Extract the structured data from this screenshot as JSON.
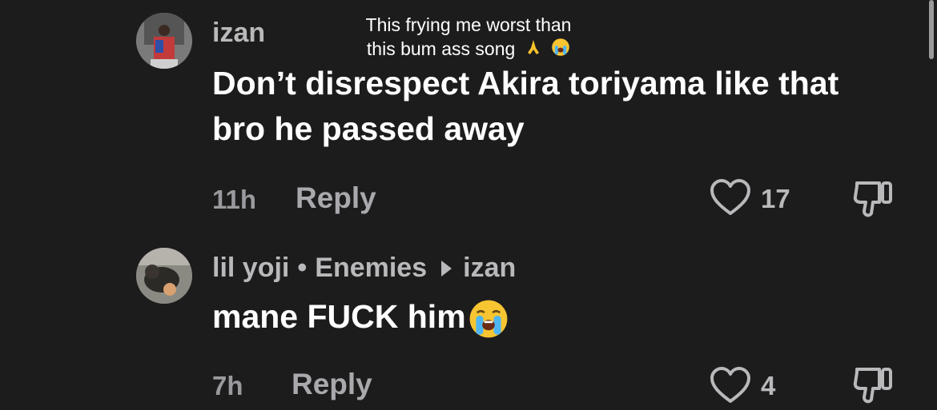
{
  "video_overlay": {
    "caption_line1": "This frying me worst than",
    "caption_line2": "this bum ass song"
  },
  "comments": [
    {
      "username": "izan",
      "text_line1": "Don’t disrespect Akira toriyama like that",
      "text_line2": "bro he passed away",
      "time": "11h",
      "reply_label": "Reply",
      "likes": "17"
    },
    {
      "username": "lil yoji",
      "separator": "•",
      "tag": "Enemies",
      "reply_to": "izan",
      "text": "mane FUCK him",
      "time": "7h",
      "reply_label": "Reply",
      "likes": "4"
    }
  ],
  "colors": {
    "background": "#1c1c1d",
    "primary_text": "#ffffff",
    "secondary_text": "#b9b9bc"
  },
  "icons": [
    "heart-icon",
    "thumbs-down-icon",
    "loudly-crying-face-emoji",
    "folded-hands-emoji"
  ]
}
